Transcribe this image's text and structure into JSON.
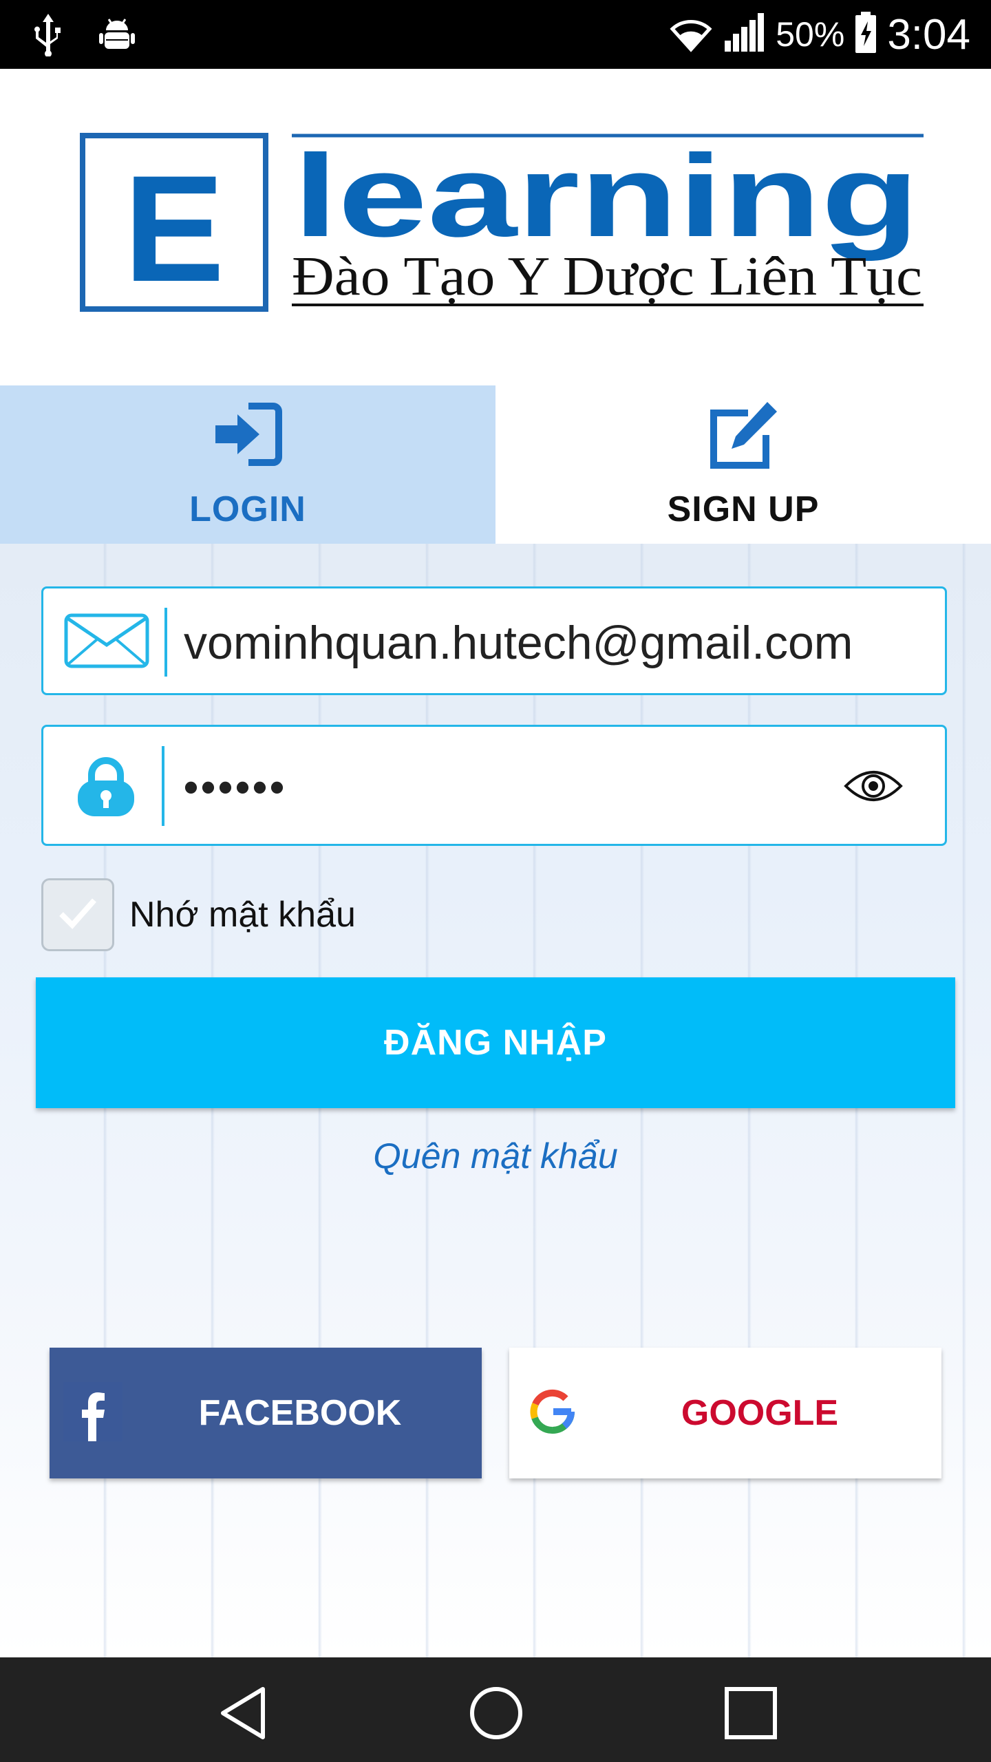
{
  "status_bar": {
    "battery_percent": "50%",
    "time": "3:04",
    "icons": [
      "usb-icon",
      "android-debug-icon",
      "wifi-icon",
      "signal-icon",
      "battery-icon"
    ]
  },
  "logo": {
    "letter": "E",
    "word": "learning",
    "tagline": "Đào Tạo Y Dược Liên Tục"
  },
  "tabs": [
    {
      "label": "LOGIN",
      "icon": "login-icon",
      "active": true
    },
    {
      "label": "SIGN UP",
      "icon": "edit-icon",
      "active": false
    }
  ],
  "form": {
    "email_value": "vominhquan.hutech@gmail.com",
    "password_value": "••••••",
    "remember_label": "Nhớ mật khẩu",
    "remember_checked": true,
    "login_button": "ĐĂNG NHẬP",
    "forgot_link": "Quên mật khẩu"
  },
  "social": {
    "facebook_label": "FACEBOOK",
    "google_label": "GOOGLE"
  },
  "colors": {
    "accent": "#01bcf9",
    "field_border": "#24b6e8",
    "tab_active_bg": "#c4ddf6",
    "link": "#1b6ec2",
    "facebook": "#3d5a96",
    "google_text": "#cc0a2f"
  }
}
